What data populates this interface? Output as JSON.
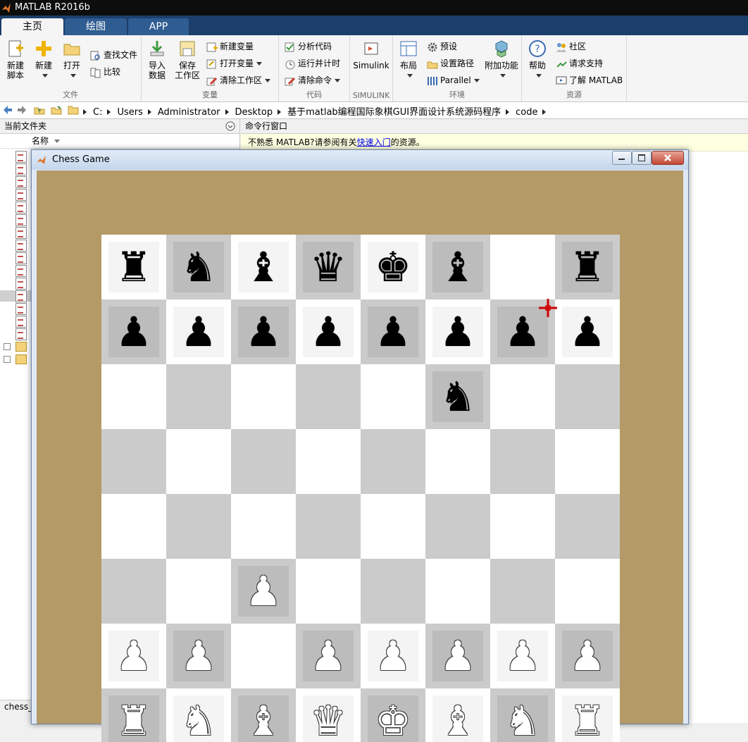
{
  "window": {
    "title": "MATLAB R2016b"
  },
  "tabs": [
    {
      "label": "主页",
      "active": true
    },
    {
      "label": "绘图",
      "active": false
    },
    {
      "label": "APP",
      "active": false
    }
  ],
  "ribbon": {
    "file": {
      "title": "文件",
      "new_script": "新建\n脚本",
      "new": "新建",
      "open": "打开",
      "find_files": "查找文件",
      "compare": "比较"
    },
    "variable": {
      "title": "变量",
      "import": "导入\n数据",
      "save": "保存\n工作区",
      "new_var": "新建变量",
      "open_var": "打开变量",
      "clear_ws": "清除工作区"
    },
    "code": {
      "title": "代码",
      "analyze": "分析代码",
      "run_time": "运行并计时",
      "clear_cmd": "清除命令"
    },
    "simulink": {
      "title": "SIMULINK",
      "label": "Simulink"
    },
    "env": {
      "title": "环境",
      "layout": "布局",
      "prefs": "预设",
      "set_path": "设置路径",
      "parallel": "Parallel",
      "addons": "附加功能"
    },
    "resources": {
      "title": "资源",
      "help": "帮助",
      "community": "社区",
      "support": "请求支持",
      "learn": "了解 MATLAB"
    }
  },
  "address": {
    "crumbs": [
      "C:",
      "Users",
      "Administrator",
      "Desktop",
      "基于matlab编程国际象棋GUI界面设计系统源码程序",
      "code"
    ]
  },
  "current_folder": {
    "title": "当前文件夹",
    "col_name": "名称",
    "status": "chess_"
  },
  "command_window": {
    "title": "命令行窗口",
    "notice_pre": "不熟悉 MATLAB?请参阅有关",
    "notice_link": "快速入门",
    "notice_post": "的资源。"
  },
  "chess_window": {
    "title": "Chess Game"
  },
  "board": {
    "rows": [
      [
        "bR",
        "bN",
        "bB",
        "bQ",
        "bK",
        "bB",
        "",
        "bR"
      ],
      [
        "bP",
        "bP",
        "bP",
        "bP",
        "bP",
        "bP",
        "bP",
        "bP"
      ],
      [
        "",
        "",
        "",
        "",
        "",
        "bN",
        "",
        ""
      ],
      [
        "",
        "",
        "",
        "",
        "",
        "",
        "",
        ""
      ],
      [
        "",
        "",
        "",
        "",
        "",
        "",
        "",
        ""
      ],
      [
        "",
        "",
        "wP",
        "",
        "",
        "",
        "",
        ""
      ],
      [
        "wP",
        "wP",
        "",
        "wP",
        "wP",
        "wP",
        "wP",
        "wP"
      ],
      [
        "wR",
        "wN",
        "wB",
        "wQ",
        "wK",
        "wB",
        "wN",
        "wR"
      ]
    ],
    "symbols": {
      "R": "♜",
      "N": "♞",
      "B": "♝",
      "Q": "♛",
      "K": "♚",
      "P": "♟"
    },
    "colors": {
      "light": "#ffffff",
      "dark": "#cbcbcb",
      "frame": "#b49a66"
    }
  }
}
